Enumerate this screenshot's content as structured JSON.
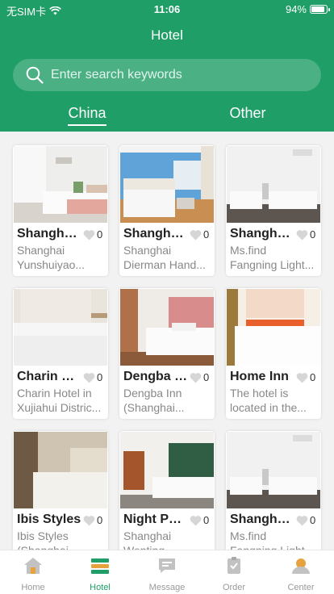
{
  "status_bar": {
    "carrier": "无SIM卡",
    "time": "11:06",
    "battery": "94%",
    "battery_level": 0.94
  },
  "nav": {
    "title": "Hotel"
  },
  "search": {
    "placeholder": "Enter search keywords"
  },
  "tabs": [
    {
      "label": "China",
      "active": true
    },
    {
      "label": "Other",
      "active": false
    }
  ],
  "hotels": [
    {
      "name": "Shanghai ...",
      "likes": "0",
      "desc1": "Shanghai",
      "desc2": "Yunshuiyao..."
    },
    {
      "name": "Shanghai ...",
      "likes": "0",
      "desc1": "Shanghai",
      "desc2": "Dierman Hand..."
    },
    {
      "name": "Shanghai ...",
      "likes": "0",
      "desc1": "Ms.find",
      "desc2": "Fangning Light..."
    },
    {
      "name": "Charin Hotel",
      "likes": "0",
      "desc1": "Charin Hotel in",
      "desc2": "Xujiahui Distric..."
    },
    {
      "name": "Dengba Inn",
      "likes": "0",
      "desc1": "Dengba Inn",
      "desc2": "(Shanghai..."
    },
    {
      "name": "Home Inn",
      "likes": "0",
      "desc1": "The hotel is",
      "desc2": "located in the..."
    },
    {
      "name": "Ibis Styles",
      "likes": "0",
      "desc1": "Ibis Styles",
      "desc2": "(Shanghai..."
    },
    {
      "name": "Night Purple",
      "likes": "0",
      "desc1": "Shanghai",
      "desc2": "Wenting..."
    },
    {
      "name": "Shanghai ...",
      "likes": "0",
      "desc1": "Ms.find",
      "desc2": "Fangning Light..."
    }
  ],
  "tabbar": [
    {
      "label": "Home",
      "icon": "home-icon",
      "active": false
    },
    {
      "label": "Hotel",
      "icon": "hotel-icon",
      "active": true
    },
    {
      "label": "Message",
      "icon": "message-icon",
      "active": false
    },
    {
      "label": "Order",
      "icon": "order-icon",
      "active": false
    },
    {
      "label": "Center",
      "icon": "center-icon",
      "active": false
    }
  ],
  "colors": {
    "accent": "#1f9e67",
    "inactive": "#999999"
  }
}
